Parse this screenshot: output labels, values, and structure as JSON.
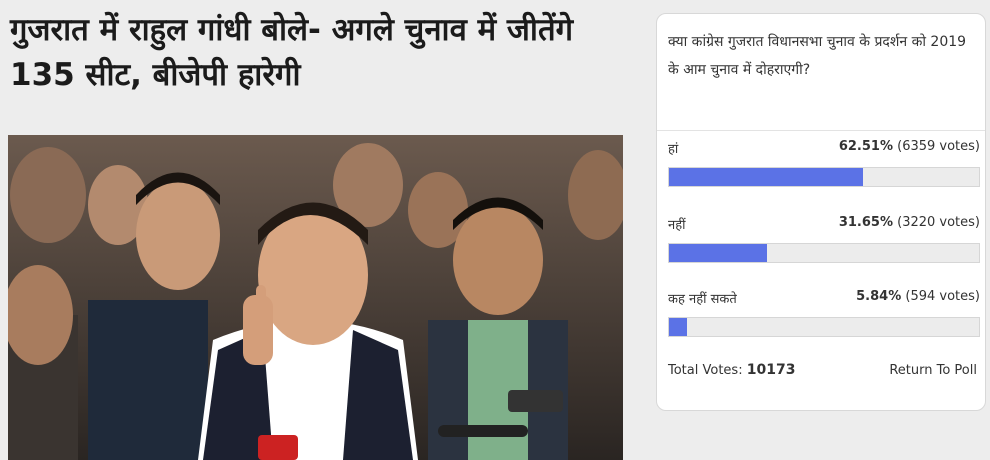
{
  "article": {
    "headline": "गुजरात में राहुल गांधी बोले- अगले चुनाव में जीतेंगे 135 सीट, बीजेपी हारेगी"
  },
  "poll": {
    "question": "क्या कांग्रेस गुजरात विधानसभा चुनाव के प्रदर्शन को 2019 के आम चुनाव में दोहराएगी?",
    "options": [
      {
        "label": "हां",
        "percent": "62.51%",
        "votes": "(6359 votes)",
        "fraction": 0.6251
      },
      {
        "label": "नहीं",
        "percent": "31.65%",
        "votes": "(3220 votes)",
        "fraction": 0.3165
      },
      {
        "label": "कह नहीं सकते",
        "percent": "5.84%",
        "votes": "(594 votes)",
        "fraction": 0.0584
      }
    ],
    "total_label": "Total Votes:",
    "total_value": "10173",
    "return_label": "Return To Poll",
    "bar_color": "#5b72e6"
  }
}
